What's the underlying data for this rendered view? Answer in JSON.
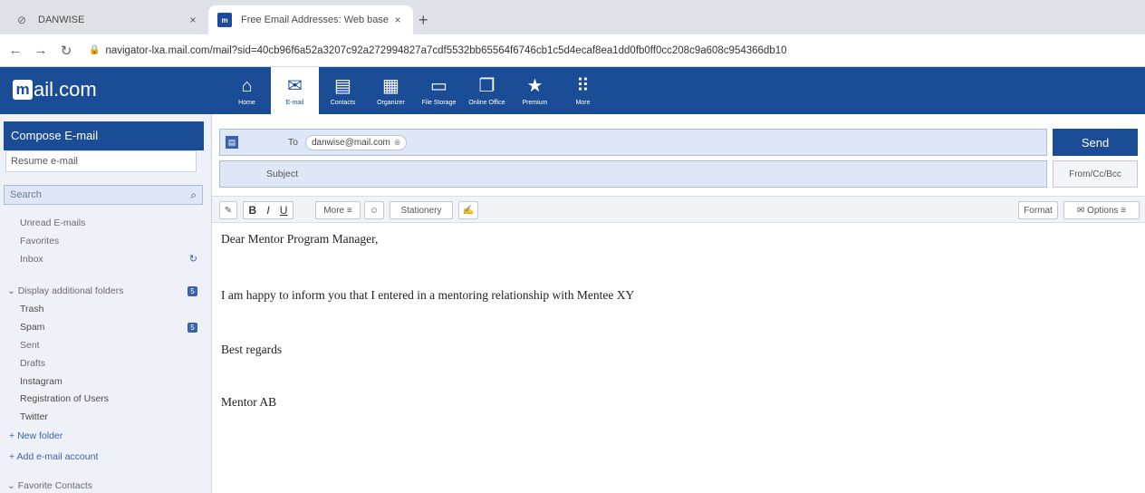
{
  "browser": {
    "tabs": [
      {
        "title": "DANWISE",
        "close": "×"
      },
      {
        "title": "Free Email Addresses: Web base",
        "close": "×"
      }
    ],
    "new_tab": "+",
    "url": "navigator-lxa.mail.com/mail?sid=40cb96f6a52a3207c92a272994827a7cdf5532bb65564f6746cb1c5d4ecaf8ea1dd0fb0ff0cc208c9a608c954366db10"
  },
  "header": {
    "logo_mark": "m",
    "logo_text": "ail.com",
    "nav": [
      {
        "label": "Home",
        "icon": "home-icon"
      },
      {
        "label": "E-mail",
        "icon": "envelope-icon"
      },
      {
        "label": "Contacts",
        "icon": "contacts-icon"
      },
      {
        "label": "Organizer",
        "icon": "calendar-icon"
      },
      {
        "label": "File Storage",
        "icon": "cloud-icon"
      },
      {
        "label": "Online Office",
        "icon": "office-icon"
      },
      {
        "label": "Premium",
        "icon": "star-icon"
      },
      {
        "label": "More",
        "icon": "grid-icon"
      }
    ]
  },
  "sidebar": {
    "compose_label": "Compose E-mail",
    "resume_label": "Resume e-mail",
    "search_placeholder": "Search",
    "folders_top": [
      "Unread E-mails",
      "Favorites",
      "Inbox"
    ],
    "additional_folders_label": "Display additional folders",
    "additional_badge": "5",
    "spam_badge": "5",
    "folders": [
      "Trash",
      "Spam",
      "Sent",
      "Drafts",
      "Instagram",
      "Registration of Users",
      "Twitter"
    ],
    "new_folder": "New folder",
    "add_account": "Add e-mail account",
    "favorite_contacts": "Favorite Contacts"
  },
  "compose": {
    "to_label": "To",
    "recipient": "danwise@mail.com",
    "subject_label": "Subject",
    "subject_value": "",
    "send_label": "Send",
    "fromcc_label": "From/Cc/Bcc",
    "toolbar": {
      "bold": "B",
      "italic": "I",
      "underline": "U",
      "more": "More ≡",
      "stationery": "Stationery",
      "format": "Format",
      "options": "Options ≡"
    },
    "body": [
      "Dear Mentor Program Manager,",
      "I am happy to inform you that I entered in a mentoring relationship with Mentee XY",
      "Best regards",
      "Mentor AB"
    ]
  },
  "colors": {
    "brand_blue": "#1b4d97",
    "sidebar_bg": "#eef2f8",
    "field_bg": "#dde7f5"
  }
}
